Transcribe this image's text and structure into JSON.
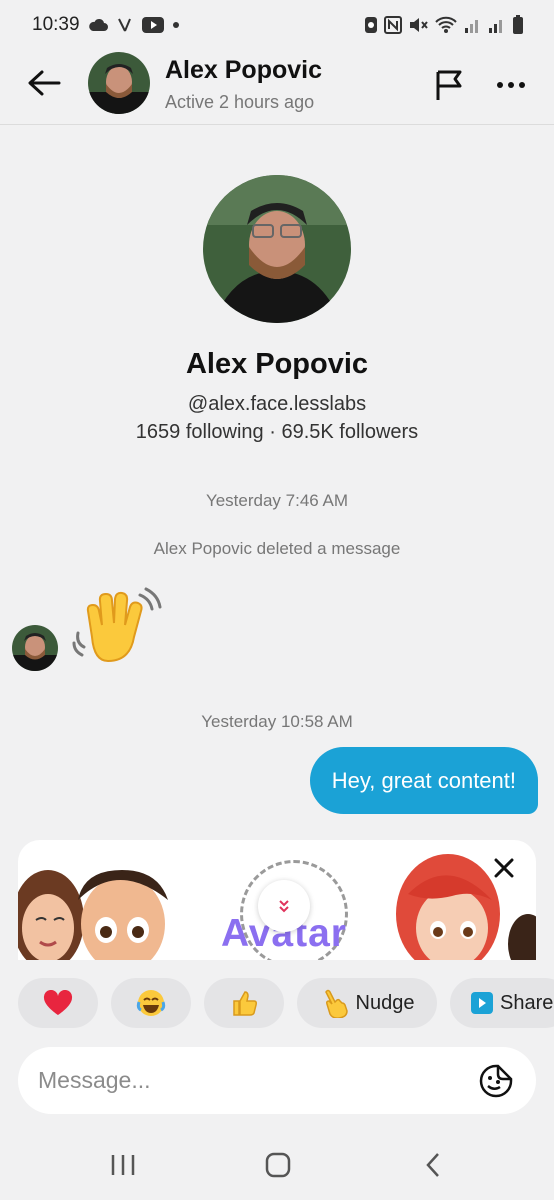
{
  "status_bar": {
    "time": "10:39",
    "icons": [
      "cloud-icon",
      "tiktok-icon",
      "youtube-icon",
      "dot-icon",
      "data-saver-icon",
      "nfc-icon",
      "mute-icon",
      "wifi-icon",
      "signal-icon",
      "signal-icon",
      "battery-icon"
    ]
  },
  "header": {
    "name": "Alex Popovic",
    "status": "Active 2 hours ago"
  },
  "profile": {
    "name": "Alex Popovic",
    "handle": "@alex.face.lesslabs",
    "stats": "1659 following · 69.5K followers"
  },
  "chat": {
    "timestamp1": "Yesterday 7:46 AM",
    "system_message": "Alex Popovic deleted a message",
    "timestamp2": "Yesterday 10:58 AM",
    "sent_message": "Hey, great content!"
  },
  "banner": {
    "title": "Avatar"
  },
  "quick_reactions": [
    {
      "icon": "heart-icon",
      "label": ""
    },
    {
      "icon": "laugh-cry-icon",
      "label": ""
    },
    {
      "icon": "thumbs-up-icon",
      "label": ""
    },
    {
      "icon": "point-icon",
      "label": "Nudge"
    },
    {
      "icon": "share-icon",
      "label": "Share"
    }
  ],
  "composer": {
    "placeholder": "Message..."
  },
  "colors": {
    "bubble": "#1ba2d6",
    "background": "#f1f1f2",
    "chip": "#e4e4e6",
    "banner_text": "#8b6ff0"
  }
}
